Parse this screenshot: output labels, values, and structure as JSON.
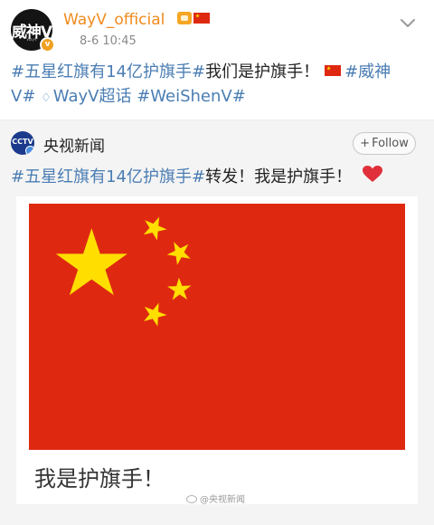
{
  "post": {
    "avatar_text": "威神V",
    "avatar_sub": "WayV",
    "username": "WayV_official",
    "timestamp": "8-6  10:45",
    "text_line1_tag": "#五星红旗有14亿护旗手#",
    "text_line1_body": "我们是护旗手！",
    "text_line1_tag2": "#威神",
    "text_line2_tag": "V#",
    "text_line2_tag2": "WayV超话",
    "text_line2_tag3": "#WeiShenV#"
  },
  "repost": {
    "avatar_text": "CCTV",
    "author": "央视新闻",
    "follow_plus": "+",
    "follow_label": "Follow",
    "text_tag": "#五星红旗有14亿护旗手#",
    "text_body": "转发！我是护旗手！",
    "image_caption": "我是护旗手！",
    "watermark": "@央视新闻"
  },
  "colors": {
    "username": "#f08a1c",
    "hashtag": "#4a7db3",
    "flag_red": "#de2910",
    "flag_yellow": "#ffde00",
    "heart": "#e0303a"
  },
  "icons": {
    "verified": "verified-badge",
    "vip": "vip-icon",
    "flag": "china-flag-icon",
    "chevron": "chevron-down-icon",
    "diamond": "diamond-icon",
    "heart": "heart-icon"
  }
}
